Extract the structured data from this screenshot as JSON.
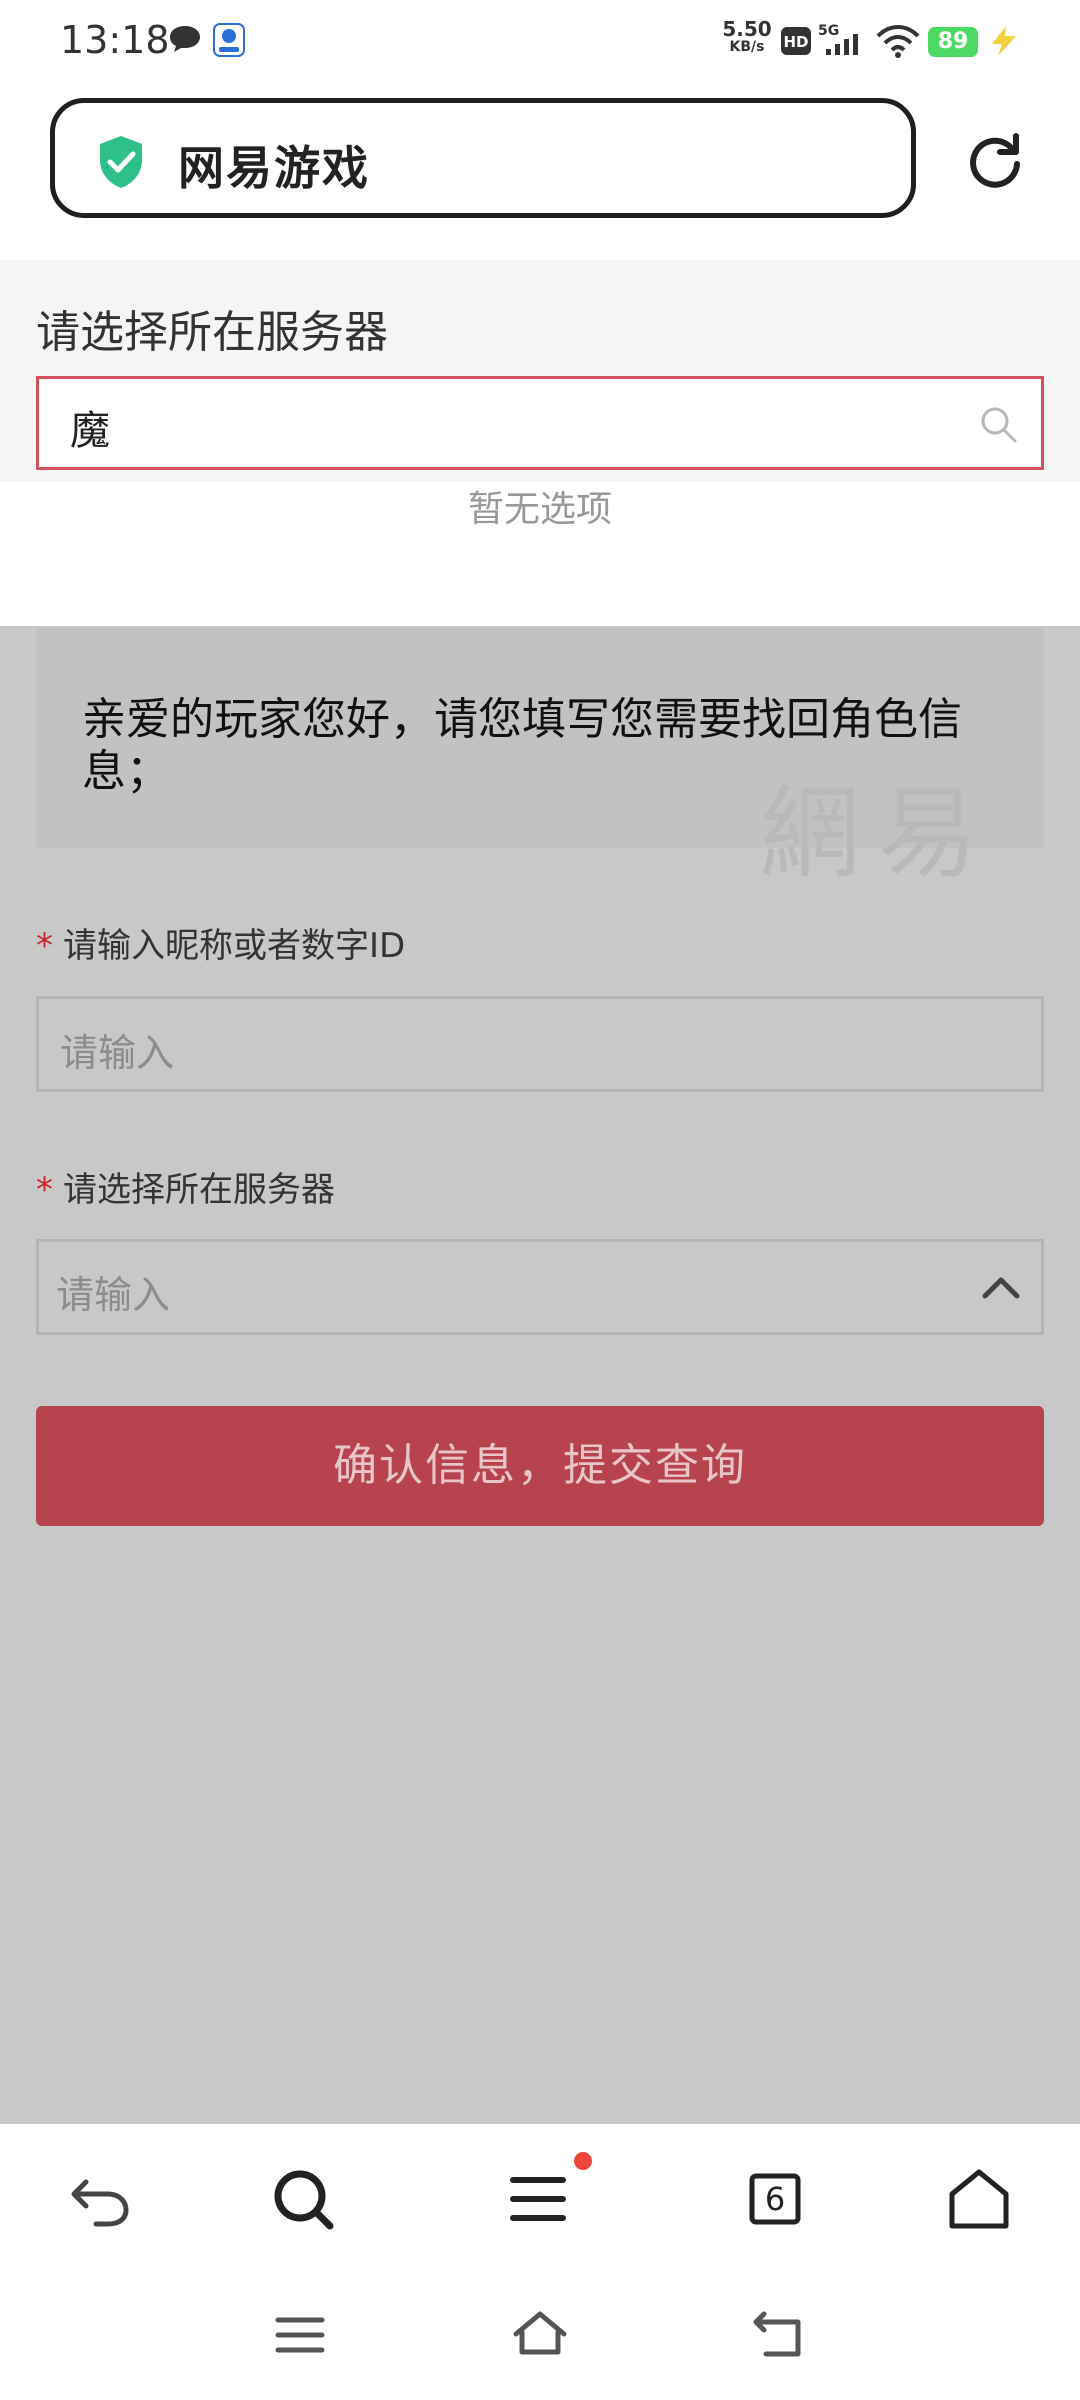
{
  "status_bar": {
    "time": "13:18",
    "net_speed_value": "5.50",
    "net_speed_unit": "KB/s",
    "hd_label": "HD",
    "network_label": "5G",
    "battery": "89",
    "battery_color": "#4cd964"
  },
  "browser": {
    "address_title": "网易游戏",
    "tab_count": "6"
  },
  "server_dropdown": {
    "title": "请选择所在服务器",
    "search_value": "魔",
    "empty_text": "暂无选项",
    "search_border_color": "#d4505c"
  },
  "form": {
    "greeting": "亲爱的玩家您好，请您填写您需要找回角色信息；",
    "watermark": "網易",
    "required_mark": "*",
    "nickname_label": "请输入昵称或者数字ID",
    "nickname_placeholder": "请输入",
    "server_label": "请选择所在服务器",
    "server_placeholder": "请输入",
    "submit_label": "确认信息，提交查询",
    "submit_color": "#b7434e"
  },
  "icons": {
    "chat": "chat-bubble-icon",
    "app_notification": "app-notification-icon",
    "security": "shield-check-icon",
    "refresh": "refresh-icon",
    "search": "search-icon",
    "dropdown": "chevron-up-icon",
    "back": "back-arrow-icon",
    "toolbar_search": "magnifier-icon",
    "menu": "menu-icon",
    "tabs": "tabs-icon",
    "home": "home-icon"
  }
}
